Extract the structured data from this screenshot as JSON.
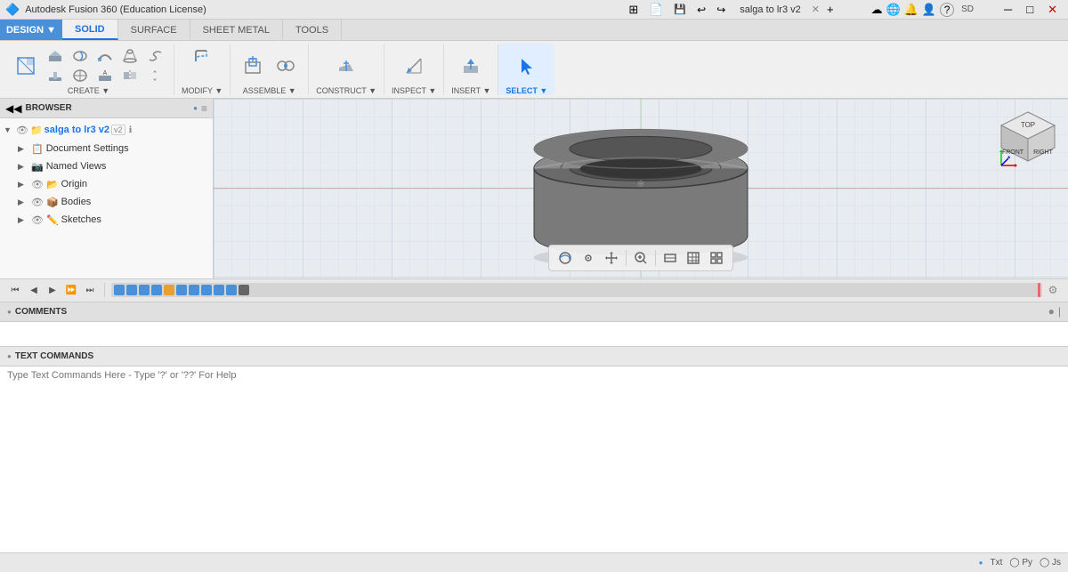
{
  "app": {
    "title": "Autodesk Fusion 360 (Education License)",
    "document_title": "salga to lr3 v2",
    "version_badge": "salga to lr3 v2"
  },
  "titlebar": {
    "title": "Autodesk Fusion 360 (Education License)",
    "controls": {
      "minimize": "─",
      "maximize": "□",
      "close": "✕"
    },
    "icons": {
      "apps": "⊞",
      "file": "📄",
      "save": "💾",
      "undo": "↩",
      "redo": "↪",
      "cloud": "☁",
      "notification": "🔔",
      "help": "?",
      "settings": "SD"
    }
  },
  "ribbon": {
    "tabs": [
      {
        "label": "SOLID",
        "active": true
      },
      {
        "label": "SURFACE",
        "active": false
      },
      {
        "label": "SHEET METAL",
        "active": false
      },
      {
        "label": "TOOLS",
        "active": false
      }
    ],
    "design_label": "DESIGN ▼",
    "sections": [
      {
        "name": "CREATE",
        "label": "CREATE ▼",
        "icons": [
          "create-sketch-icon",
          "extrude-icon",
          "revolve-icon",
          "sweep-icon",
          "loft-icon",
          "coil-icon",
          "rib-icon",
          "web-icon",
          "emboss-icon",
          "mirror-icon",
          "move-icon"
        ]
      },
      {
        "name": "MODIFY",
        "label": "MODIFY ▼",
        "icons": [
          "fillet-icon",
          "chamfer-icon",
          "shell-icon",
          "draft-icon",
          "scale-icon",
          "combine-icon",
          "split-icon",
          "thicken-icon"
        ]
      },
      {
        "name": "ASSEMBLE",
        "label": "ASSEMBLE ▼",
        "icons": [
          "new-component-icon",
          "joint-icon"
        ]
      },
      {
        "name": "CONSTRUCT",
        "label": "CONSTRUCT ▼",
        "icons": [
          "plane-icon"
        ]
      },
      {
        "name": "INSPECT",
        "label": "INSPECT ▼",
        "icons": [
          "measure-icon"
        ]
      },
      {
        "name": "INSERT",
        "label": "INSERT ▼",
        "icons": [
          "insert-icon"
        ]
      },
      {
        "name": "SELECT",
        "label": "SELECT ▼",
        "icons": [
          "select-icon"
        ]
      }
    ]
  },
  "browser": {
    "title": "BROWSER",
    "items": [
      {
        "level": 0,
        "label": "salga to lr3 v2",
        "hasArrow": true,
        "hasEye": true,
        "isRoot": true
      },
      {
        "level": 1,
        "label": "Document Settings",
        "hasArrow": true,
        "hasEye": false
      },
      {
        "level": 1,
        "label": "Named Views",
        "hasArrow": true,
        "hasEye": false
      },
      {
        "level": 1,
        "label": "Origin",
        "hasArrow": true,
        "hasEye": true
      },
      {
        "level": 1,
        "label": "Bodies",
        "hasArrow": true,
        "hasEye": true
      },
      {
        "level": 1,
        "label": "Sketches",
        "hasArrow": true,
        "hasEye": true
      }
    ]
  },
  "viewport": {
    "grid_color": "#d0d8e0",
    "background_color": "#e8ecf0"
  },
  "viewcube": {
    "top": "TOP",
    "front": "FRONT",
    "right": "RIGHT"
  },
  "timeline": {
    "buttons": [
      "⏮",
      "◀",
      "▶",
      "⏩",
      "⏭"
    ],
    "icons": [
      "timeline-icon-1",
      "timeline-icon-2",
      "timeline-icon-3",
      "timeline-icon-4",
      "timeline-icon-5",
      "timeline-icon-6",
      "timeline-icon-7",
      "timeline-icon-8",
      "timeline-icon-9",
      "timeline-icon-10",
      "timeline-icon-11"
    ]
  },
  "view_toolbar": {
    "buttons": [
      "orbit-icon",
      "pan-icon",
      "zoom-icon",
      "fit-icon",
      "display-mode-icon",
      "grid-icon",
      "view-icon"
    ]
  },
  "comments": {
    "title": "COMMENTS",
    "dot_indicator": "●"
  },
  "text_commands": {
    "title": "TEXT COMMANDS",
    "dot_indicator": "●",
    "placeholder": "Type Text Commands Here - Type '?' or '??' For Help"
  },
  "statusbar": {
    "left_text": "",
    "right_items": [
      "Txt",
      "Py",
      "Js"
    ]
  }
}
